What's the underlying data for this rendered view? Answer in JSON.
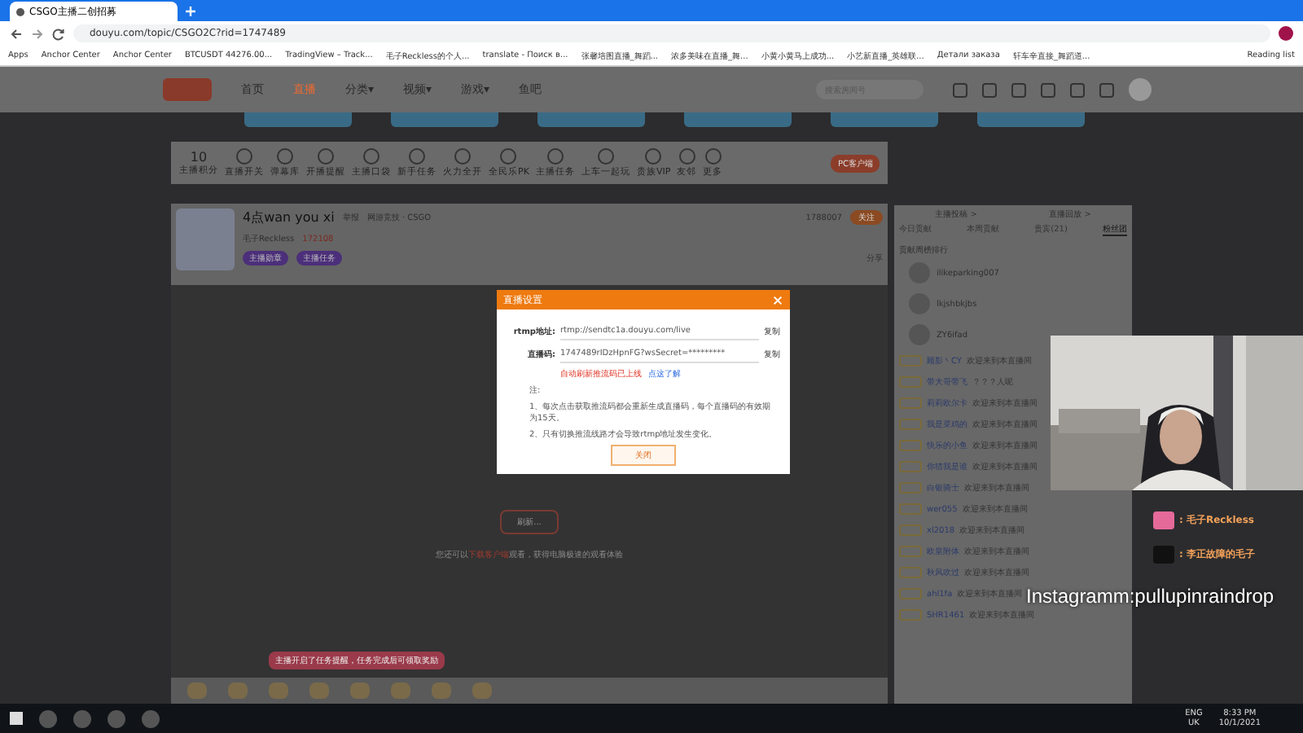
{
  "browser": {
    "tab_title": "CSGO主播二创招募",
    "url": "douyu.com/topic/CSGO2C?rid=1747489",
    "bookmarks": [
      {
        "label": "Apps"
      },
      {
        "label": "Anchor Center"
      },
      {
        "label": "Anchor Center"
      },
      {
        "label": "BTCUSDT 44276.00..."
      },
      {
        "label": "TradingView – Track..."
      },
      {
        "label": "毛子Reckless的个人..."
      },
      {
        "label": "translate - Поиск в..."
      },
      {
        "label": "张馨培图直播_舞蹈..."
      },
      {
        "label": "浓多美味在直播_舞..."
      },
      {
        "label": "小黄小黄马上成功..."
      },
      {
        "label": "小艺新直播_英雄联..."
      },
      {
        "label": "Детали заказа"
      },
      {
        "label": "轩车辛直接_舞蹈道..."
      }
    ],
    "reading_list": "Reading list"
  },
  "nav": {
    "items": [
      {
        "label": "首页",
        "selected": false
      },
      {
        "label": "直播",
        "selected": true
      },
      {
        "label": "分类▾",
        "selected": false
      },
      {
        "label": "视频▾",
        "selected": false
      },
      {
        "label": "游戏▾",
        "selected": false
      },
      {
        "label": "鱼吧",
        "selected": false
      }
    ],
    "search": {
      "placeholder": "搜索房间号"
    }
  },
  "toolbar": {
    "score": "10",
    "score_label": "主播积分",
    "items": [
      {
        "label": "直播开关"
      },
      {
        "label": "弹幕库"
      },
      {
        "label": "开播提醒"
      },
      {
        "label": "主播口袋"
      },
      {
        "label": "新手任务"
      },
      {
        "label": "火力全开"
      },
      {
        "label": "全民乐PK"
      },
      {
        "label": "主播任务"
      },
      {
        "label": "上车一起玩"
      },
      {
        "label": "贵族VIP"
      },
      {
        "label": "友邻"
      },
      {
        "label": "更多"
      }
    ],
    "client_button": "PC客户端"
  },
  "room": {
    "title": "4点wan you xi",
    "report": "举报",
    "category": "网游竞技 · CSGO",
    "anchor": "毛子Reckless",
    "heat": "172108",
    "followers": "1788007",
    "follow_button": "关注",
    "share": "分享",
    "tags": [
      "主播勋章",
      "主播任务"
    ]
  },
  "video": {
    "refresh_button": "刷新...",
    "hint": "您还可以**下载客户端**观看，获得电脑极速的观看体验"
  },
  "dialog": {
    "title": "直播设置",
    "rtmp_label": "rtmp地址:",
    "rtmp_value": "rtmp://sendtc1a.douyu.com/live",
    "code_label": "直播码:",
    "code_value": "1747489rIDzHpnFG?wsSecret=*********",
    "copy_rtmp": "复制",
    "copy_code": "复制",
    "notice": "自动刷新推流码已上线",
    "notice_link": "点这了解",
    "notes": [
      "注:",
      "1、每次点击获取推流码都会重新生成直播码，每个直播码的有效期为15天。",
      "2、只有切换推流线路才会导致rtmp地址发生变化。"
    ],
    "close_button": "关闭"
  },
  "chat": {
    "links": [
      "主播投稿 >",
      "直播回放 >"
    ],
    "tabs": [
      {
        "label": "今日贡献",
        "selected": false
      },
      {
        "label": "本周贡献",
        "selected": false
      },
      {
        "label": "贵宾(21)",
        "selected": false
      },
      {
        "label": "粉丝团",
        "selected": true
      }
    ],
    "ranking_title": "贡献周榜排行",
    "ranking": [
      {
        "name": "ilikeparking007"
      },
      {
        "name": "lkjshbkjbs"
      },
      {
        "name": "ZY6ifad"
      }
    ],
    "messages": [
      {
        "user": "顾影丶CY",
        "text": "欢迎来到本直播间"
      },
      {
        "user": "带大哥带飞",
        "text": "？？？人呢"
      },
      {
        "user": "莉莉欧尔卡",
        "text": "欢迎来到本直播间"
      },
      {
        "user": "我是菜鸡的",
        "text": "欢迎来到本直播间"
      },
      {
        "user": "快乐的小鱼",
        "text": "欢迎来到本直播间"
      },
      {
        "user": "你猜我是谁",
        "text": "欢迎来到本直播间"
      },
      {
        "user": "白银骑士",
        "text": "欢迎来到本直播间"
      },
      {
        "user": "wer055",
        "text": "欢迎来到本直播间"
      },
      {
        "user": "xl2018",
        "text": "欢迎来到本直播间"
      },
      {
        "user": "欧皇附体",
        "text": "欢迎来到本直播间"
      },
      {
        "user": "秋风吹过",
        "text": "欢迎来到本直播间"
      },
      {
        "user": "ahl1fa",
        "text": "欢迎来到本直播间"
      },
      {
        "user": "SHR1461",
        "text": "欢迎来到本直播间"
      }
    ]
  },
  "overlay": {
    "lines": [
      ": 毛子Reckless",
      ": 李正故障的毛子"
    ],
    "instagram": "Instagramm:pullupinraindrop"
  },
  "tip": "主播开启了任务提醒，任务完成后可领取奖励",
  "taskbar": {
    "lang": "ENG",
    "region": "UK",
    "time": "8:33 PM",
    "date": "10/1/2021"
  }
}
